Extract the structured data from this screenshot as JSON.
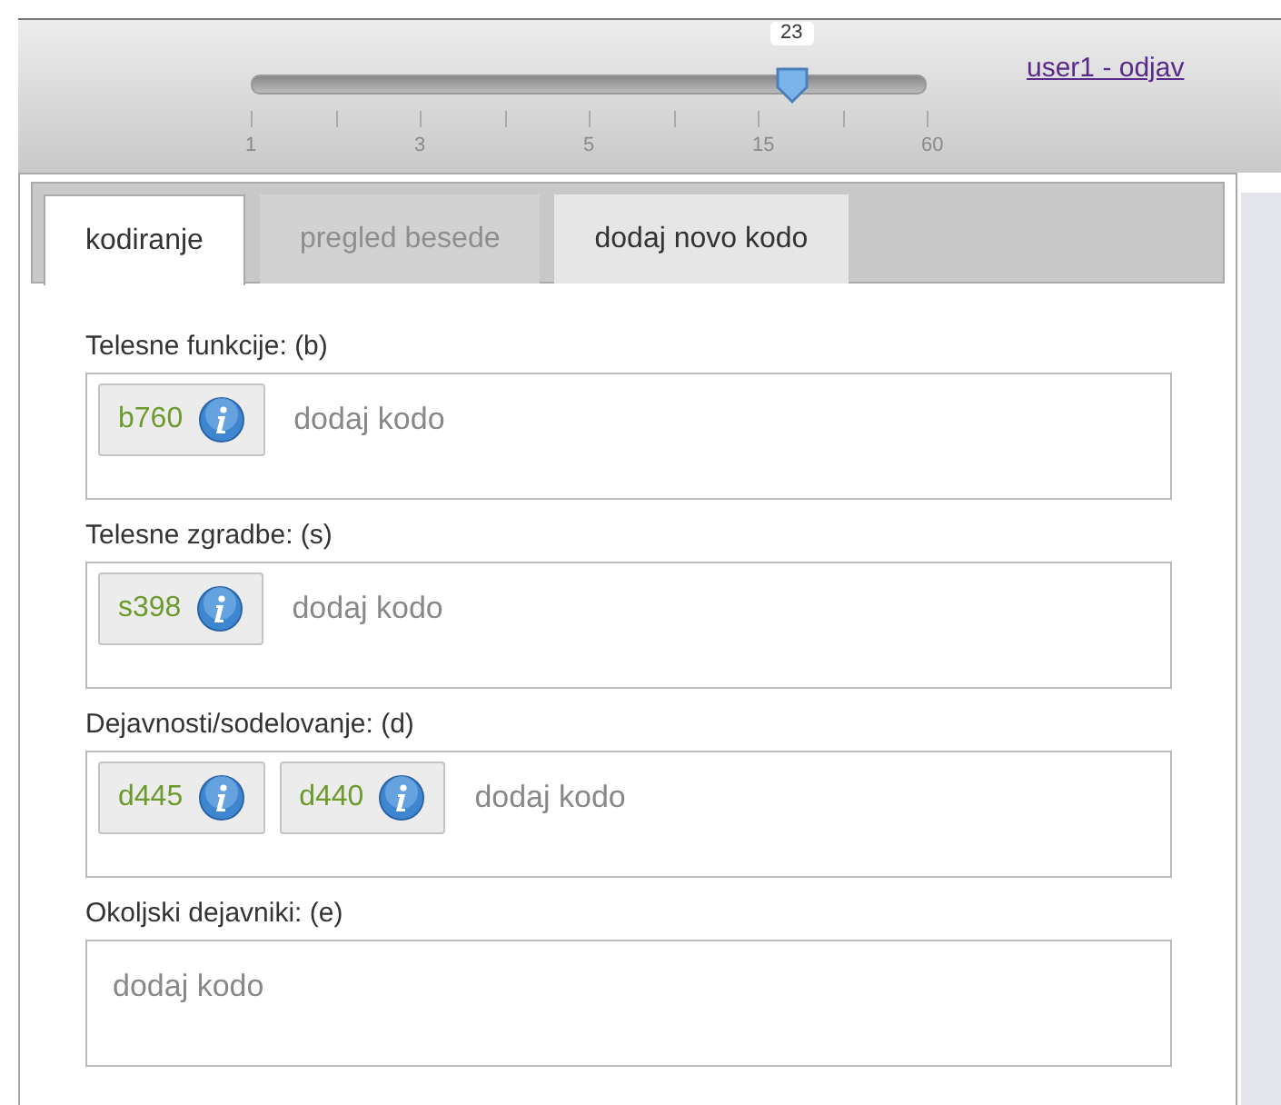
{
  "slider": {
    "level": 0.8,
    "value": "23",
    "tick_labels": [
      "1",
      "3",
      "5",
      "15",
      "60"
    ]
  },
  "user_link": "user1 - odjav",
  "tabs": [
    {
      "label": "kodiranje",
      "selected": true,
      "disabled": false
    },
    {
      "label": "pregled besede",
      "selected": false,
      "disabled": true
    },
    {
      "label": "dodaj novo kodo",
      "selected": false,
      "disabled": false
    }
  ],
  "sections": [
    {
      "label": "Telesne funkcije: (b)",
      "codes": [
        "b760"
      ],
      "placeholder": "dodaj kodo"
    },
    {
      "label": "Telesne zgradbe: (s)",
      "codes": [
        "s398"
      ],
      "placeholder": "dodaj kodo"
    },
    {
      "label": "Dejavnosti/sodelovanje: (d)",
      "codes": [
        "d445",
        "d440"
      ],
      "placeholder": "dodaj kodo"
    },
    {
      "label": "Okoljski dejavniki: (e)",
      "placeholder": "dodaj kodo"
    }
  ]
}
